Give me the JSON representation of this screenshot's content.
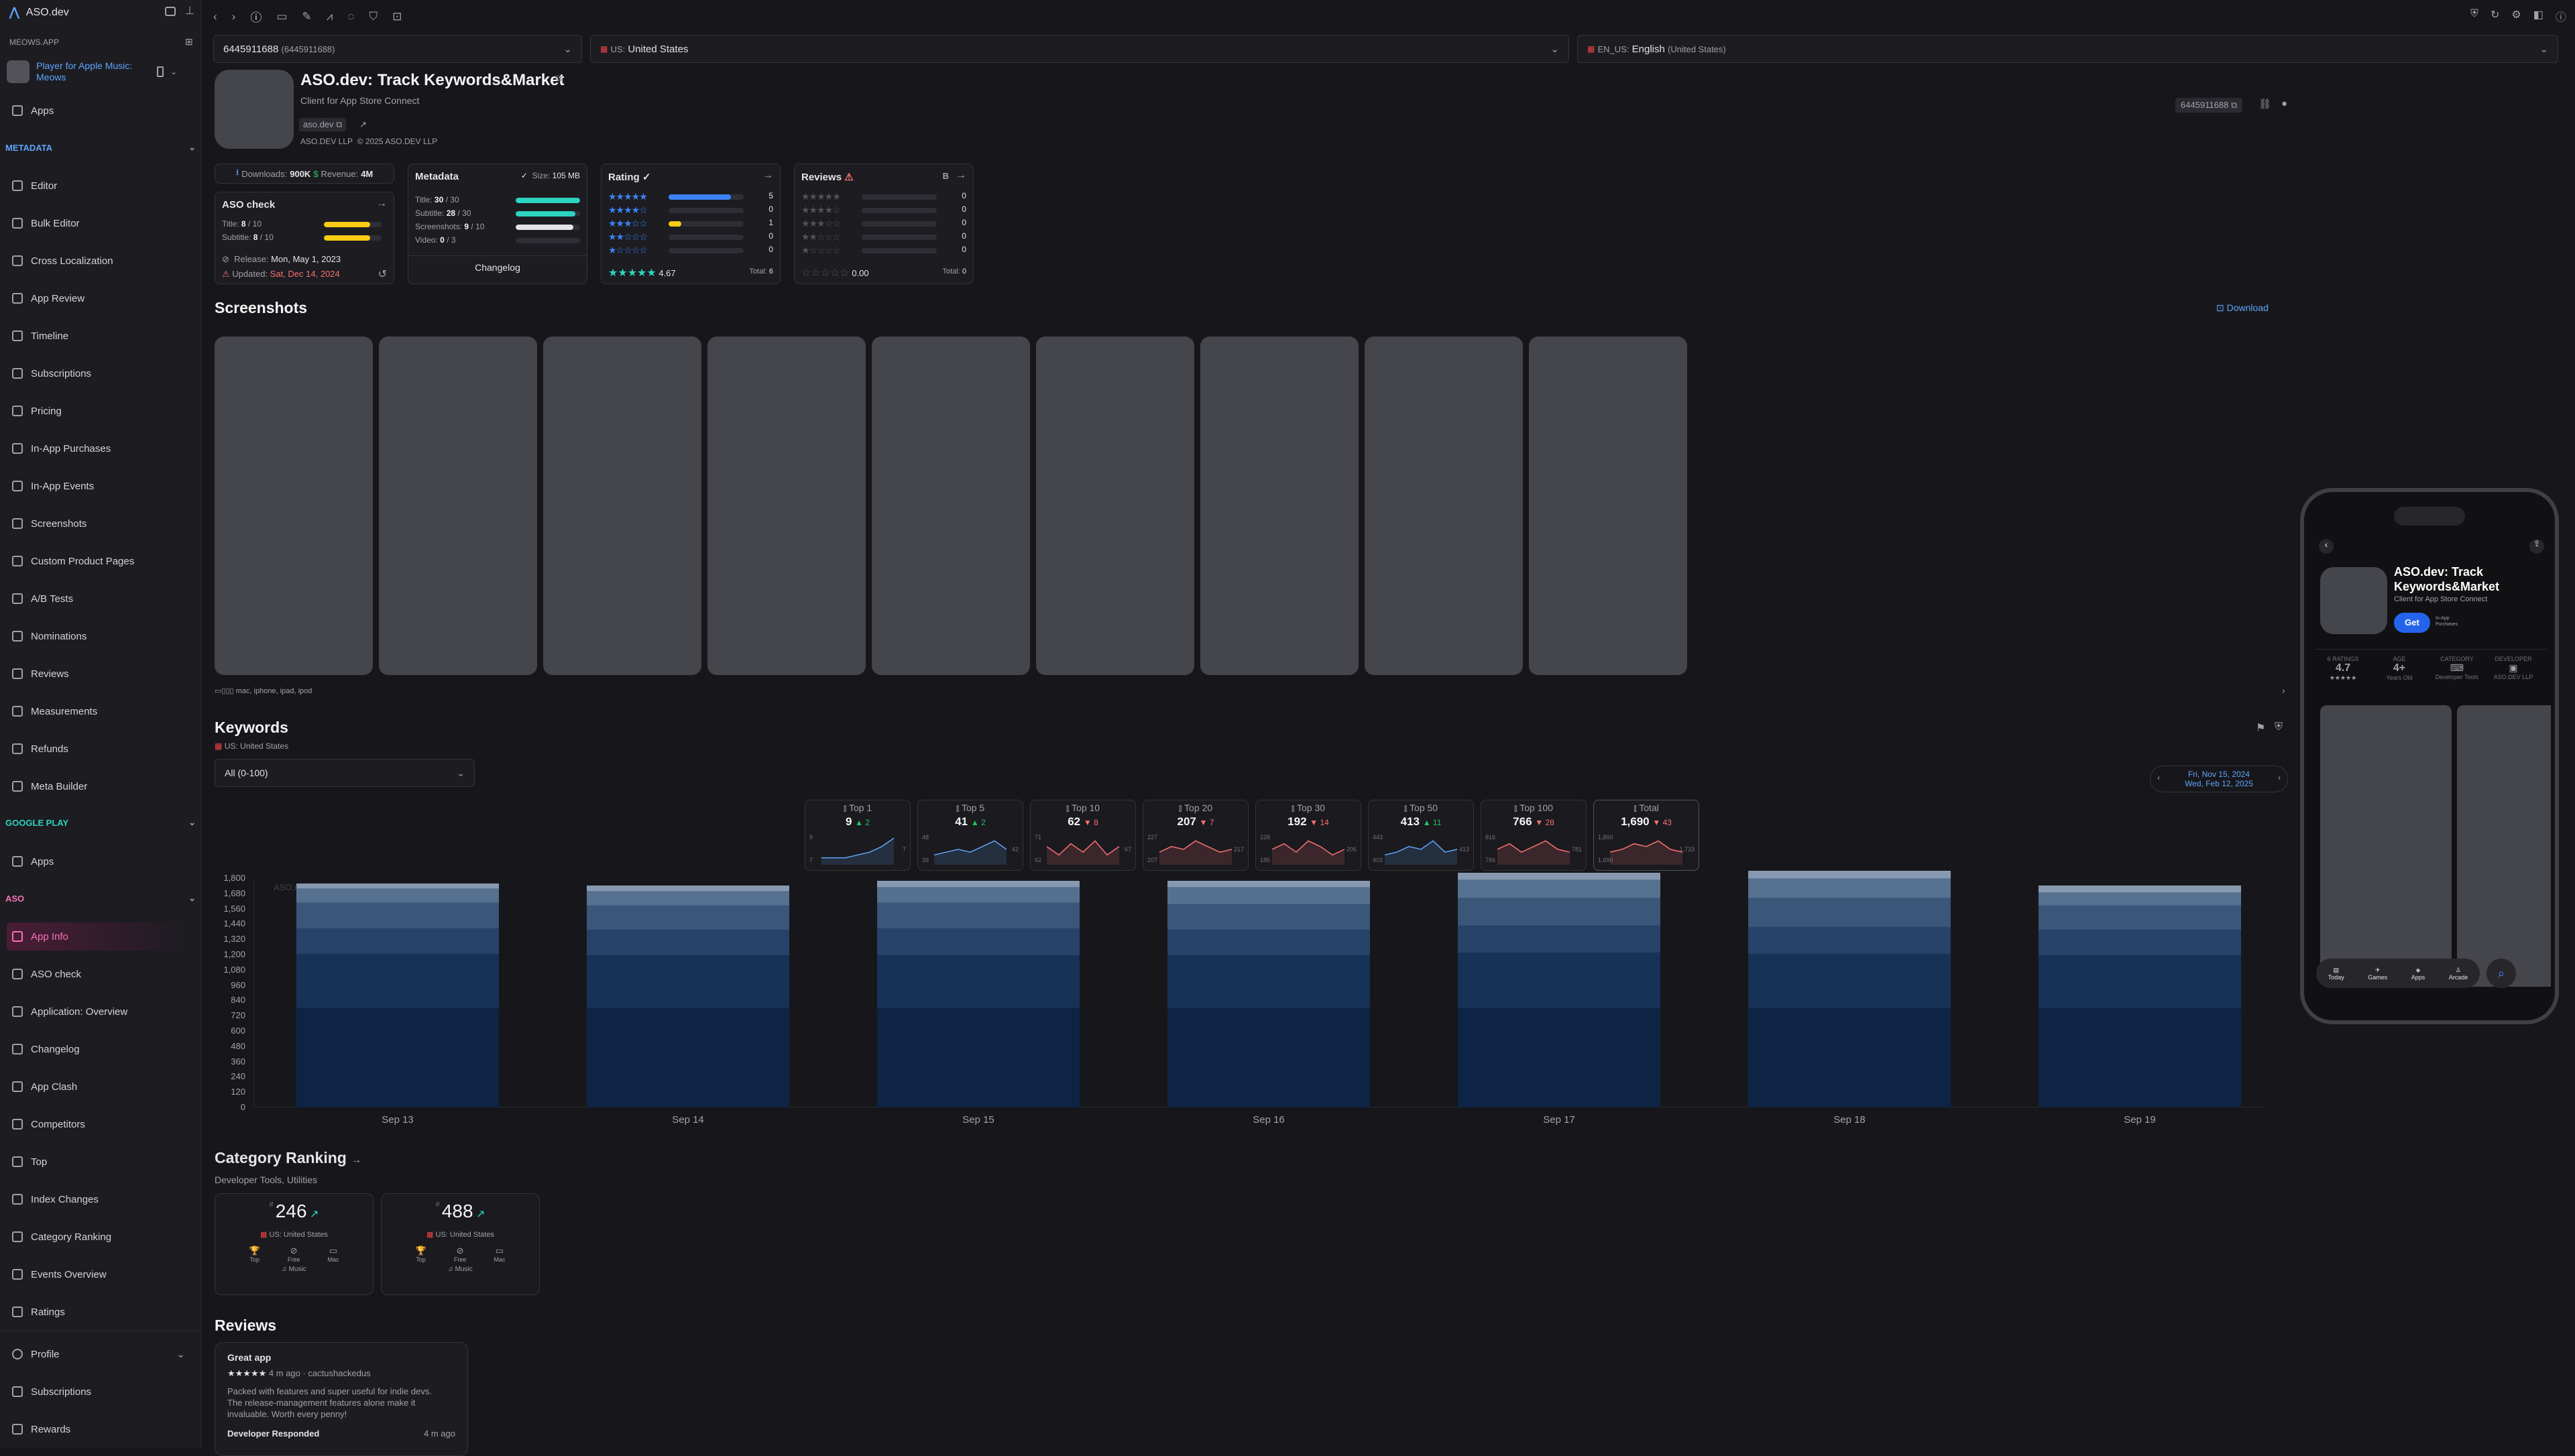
{
  "colors": {
    "accent": "#3b82f6",
    "brand": "#e11d74",
    "warning": "#facc15",
    "teal": "#2dd4bf",
    "red": "#f87171"
  },
  "sidebar": {
    "app_name": "ASO.dev",
    "workspace": "MEOWS.APP",
    "app_title": "Player for Apple Music: Meows",
    "apps_label": "Apps",
    "metadata_header": "METADATA",
    "metadata_items": [
      "Editor",
      "Bulk Editor",
      "Cross Localization",
      "App Review",
      "Timeline",
      "Subscriptions",
      "Pricing",
      "In-App Purchases",
      "In-App Events",
      "Screenshots",
      "Custom Product Pages",
      "A/B Tests",
      "Nominations",
      "Reviews",
      "Measurements",
      "Refunds",
      "Meta Builder"
    ],
    "gp_header": "GOOGLE PLAY",
    "gp_apps": "Apps",
    "aso_header": "ASO",
    "aso_items": [
      "App Info",
      "ASO check",
      "Application: Overview",
      "Changelog",
      "App Clash",
      "Competitors",
      "Top",
      "Index Changes",
      "Category Ranking",
      "Events Overview",
      "Ratings"
    ],
    "profile": "Profile",
    "profile_items": [
      "Subscriptions",
      "Rewards"
    ]
  },
  "toolbar": {
    "app_id": "6445911688",
    "app_id_sub": "(6445911688)",
    "country_code": "US:",
    "country": "United States",
    "locale_code": "EN_US:",
    "locale": "English",
    "locale_sub": "(United States)"
  },
  "app": {
    "title": "ASO.dev: Track Keywords&Market",
    "subtitle": "Client for App Store Connect",
    "url": "aso.dev",
    "developer": "ASO.DEV LLP",
    "copyright": "© 2025 ASO.DEV LLP",
    "id_badge": "6445911688"
  },
  "stats": {
    "downloads_label": "Downloads:",
    "downloads": "900K",
    "revenue_label": "Revenue:",
    "revenue": "4M"
  },
  "aso_check": {
    "title": "ASO check",
    "title_row": "Title:",
    "title_val": "8",
    "title_max": "/ 10",
    "subtitle_row": "Subtitle:",
    "subtitle_val": "8",
    "subtitle_max": "/ 10",
    "release_label": "Release:",
    "release": "Mon, May 1, 2023",
    "updated_label": "Updated:",
    "updated": "Sat, Dec 14, 2024"
  },
  "metadata": {
    "title": "Metadata",
    "size_label": "Size:",
    "size": "105 MB",
    "rows": [
      {
        "label": "Title:",
        "val": "30",
        "max": "/ 30",
        "fill": 1.0
      },
      {
        "label": "Subtitle:",
        "val": "28",
        "max": "/ 30",
        "fill": 0.93
      },
      {
        "label": "Screenshots:",
        "val": "9",
        "max": "/ 10",
        "fill": 0.9
      },
      {
        "label": "Video:",
        "val": "0",
        "max": "/ 3",
        "fill": 0
      }
    ],
    "changelog": "Changelog"
  },
  "rating": {
    "title": "Rating",
    "counts": [
      "5",
      "0",
      "1",
      "0",
      "0"
    ],
    "fills": [
      0.83,
      0,
      0.17,
      0,
      0
    ],
    "avg": "4.67",
    "total_label": "Total:",
    "total": "6"
  },
  "reviews_card": {
    "title": "Reviews",
    "counts": [
      "0",
      "0",
      "0",
      "0",
      "0"
    ],
    "avg": "0.00",
    "total_label": "Total:",
    "total": "0"
  },
  "screenshots": {
    "title": "Screenshots",
    "download": "Download",
    "devices": "mac, iphone, ipad, ipod",
    "count": 9
  },
  "keywords": {
    "title": "Keywords",
    "country": "US: United States",
    "filter": "All (0-100)",
    "date_from": "Fri, Nov 15, 2024",
    "date_to": "Wed, Feb 12, 2025",
    "tiles": [
      {
        "label": "Top 1",
        "value": "9",
        "delta": "▲ 2",
        "min": "7",
        "max": "9",
        "last": "7"
      },
      {
        "label": "Top 5",
        "value": "41",
        "delta": "▲ 2",
        "min": "39",
        "max": "48",
        "last": "42"
      },
      {
        "label": "Top 10",
        "value": "62",
        "delta": "▼ 8",
        "min": "62",
        "max": "71",
        "last": "67"
      },
      {
        "label": "Top 20",
        "value": "207",
        "delta": "▼ 7",
        "min": "207",
        "max": "227",
        "last": "217"
      },
      {
        "label": "Top 30",
        "value": "192",
        "delta": "▼ 14",
        "min": "185",
        "max": "228",
        "last": "206"
      },
      {
        "label": "Top 50",
        "value": "413",
        "delta": "▲ 11",
        "min": "403",
        "max": "443",
        "last": "413"
      },
      {
        "label": "Top 100",
        "value": "766",
        "delta": "▼ 28",
        "min": "766",
        "max": "816",
        "last": "781"
      },
      {
        "label": "Total",
        "value": "1,690",
        "delta": "▼ 43",
        "min": "1,690",
        "max": "1,800",
        "last": "1,733"
      }
    ],
    "chart_ghost": "ASO.dev"
  },
  "chart_data": {
    "type": "bar",
    "stacked": true,
    "categories": [
      "Sep 13",
      "Sep 14",
      "Sep 15",
      "Sep 16",
      "Sep 17",
      "Sep 18",
      "Sep 19"
    ],
    "yticks": [
      "1,800",
      "1,680",
      "1,560",
      "1,440",
      "1,320",
      "1,200",
      "1,080",
      "960",
      "840",
      "720",
      "600",
      "480",
      "360",
      "240",
      "120",
      "0"
    ],
    "ylim": [
      0,
      1800
    ],
    "series": [
      {
        "values": [
          790,
          790,
          790,
          790,
          790,
          790,
          790
        ],
        "color": "#0e2444"
      },
      {
        "values": [
          420,
          410,
          410,
          410,
          430,
          420,
          410
        ],
        "color": "#163257"
      },
      {
        "values": [
          200,
          200,
          210,
          200,
          210,
          210,
          200
        ],
        "color": "#27436a"
      },
      {
        "values": [
          200,
          190,
          200,
          200,
          220,
          230,
          190
        ],
        "color": "#3a5678"
      },
      {
        "values": [
          110,
          110,
          120,
          130,
          140,
          150,
          100
        ],
        "color": "#56708f"
      },
      {
        "values": [
          40,
          40,
          50,
          50,
          50,
          60,
          50
        ],
        "color": "#8799b0"
      }
    ]
  },
  "category_ranking": {
    "title": "Category Ranking",
    "subtitle": "Developer Tools, Utilities",
    "cards": [
      {
        "rank": "246",
        "country": "US: United States",
        "labels": [
          "Top",
          "Free",
          "Mac"
        ],
        "genre": "Music"
      },
      {
        "rank": "488",
        "country": "US: United States",
        "labels": [
          "Top",
          "Free",
          "Mac"
        ],
        "genre": "Music"
      }
    ]
  },
  "reviews": {
    "title": "Reviews",
    "item": {
      "title": "Great app",
      "meta": "4 m ago · cactushackedus",
      "body": "Packed with features and super useful for indie devs. The release-management features alone make it invaluable. Worth every penny!",
      "responded": "Developer Responded",
      "responded_time": "4 m ago"
    }
  },
  "phone": {
    "title": "ASO.dev: Track Keywords&Market",
    "subtitle": "Client for App Store Connect",
    "get": "Get",
    "iap": "In-App Purchases",
    "ratings_label": "6 RATINGS",
    "rating": "4.7",
    "age_label": "AGE",
    "age": "4+",
    "age_sub": "Years Old",
    "cat_label": "CATEGORY",
    "cat_sub": "Developer Tools",
    "dev_label": "DEVELOPER",
    "dev_sub": "ASO.DEV LLP",
    "tabs": [
      "Today",
      "Games",
      "Apps",
      "Arcade"
    ]
  }
}
